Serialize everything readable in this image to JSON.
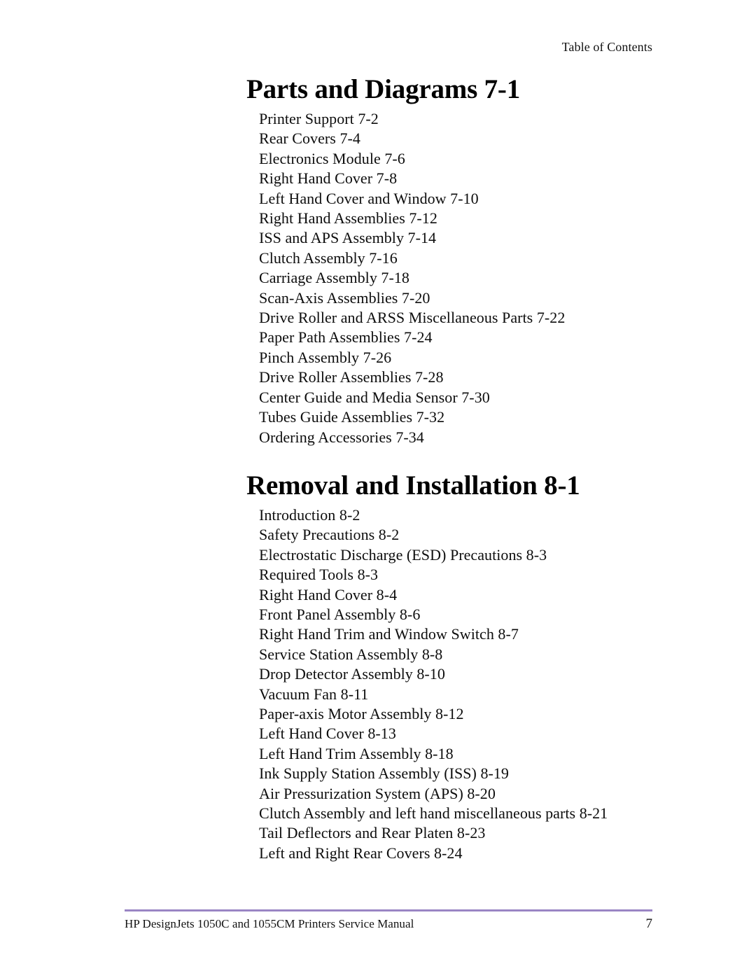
{
  "header": {
    "running_title": "Table of Contents"
  },
  "sections": [
    {
      "heading": "Parts and Diagrams 7-1",
      "entries": [
        "Printer Support 7-2",
        "Rear Covers 7-4",
        "Electronics Module 7-6",
        "Right Hand Cover 7-8",
        "Left Hand Cover and Window 7-10",
        "Right Hand Assemblies 7-12",
        "ISS and APS Assembly 7-14",
        "Clutch Assembly 7-16",
        "Carriage Assembly 7-18",
        "Scan-Axis Assemblies 7-20",
        "Drive Roller and ARSS Miscellaneous Parts 7-22",
        "Paper Path Assemblies 7-24",
        "Pinch Assembly 7-26",
        "Drive Roller Assemblies 7-28",
        "Center Guide and Media Sensor 7-30",
        "Tubes Guide Assemblies 7-32",
        "Ordering Accessories 7-34"
      ]
    },
    {
      "heading": "Removal and Installation 8-1",
      "entries": [
        "Introduction 8-2",
        "Safety Precautions 8-2",
        "Electrostatic Discharge (ESD) Precautions 8-3",
        "Required Tools 8-3",
        "Right Hand Cover 8-4",
        "Front Panel Assembly 8-6",
        "Right Hand Trim and Window Switch 8-7",
        "Service Station Assembly 8-8",
        "Drop Detector Assembly 8-10",
        "Vacuum Fan 8-11",
        "Paper-axis Motor Assembly 8-12",
        "Left Hand Cover 8-13",
        "Left Hand Trim Assembly 8-18",
        "Ink Supply Station Assembly (ISS) 8-19",
        "Air Pressurization System (APS) 8-20",
        "Clutch Assembly and left hand miscellaneous parts 8-21",
        "Tail Deflectors and Rear Platen 8-23",
        "Left and Right Rear Covers 8-24"
      ]
    }
  ],
  "footer": {
    "manual_title": "HP DesignJets 1050C and 1055CM Printers Service Manual",
    "page_number": "7",
    "rule_color": "#9a85c4"
  }
}
